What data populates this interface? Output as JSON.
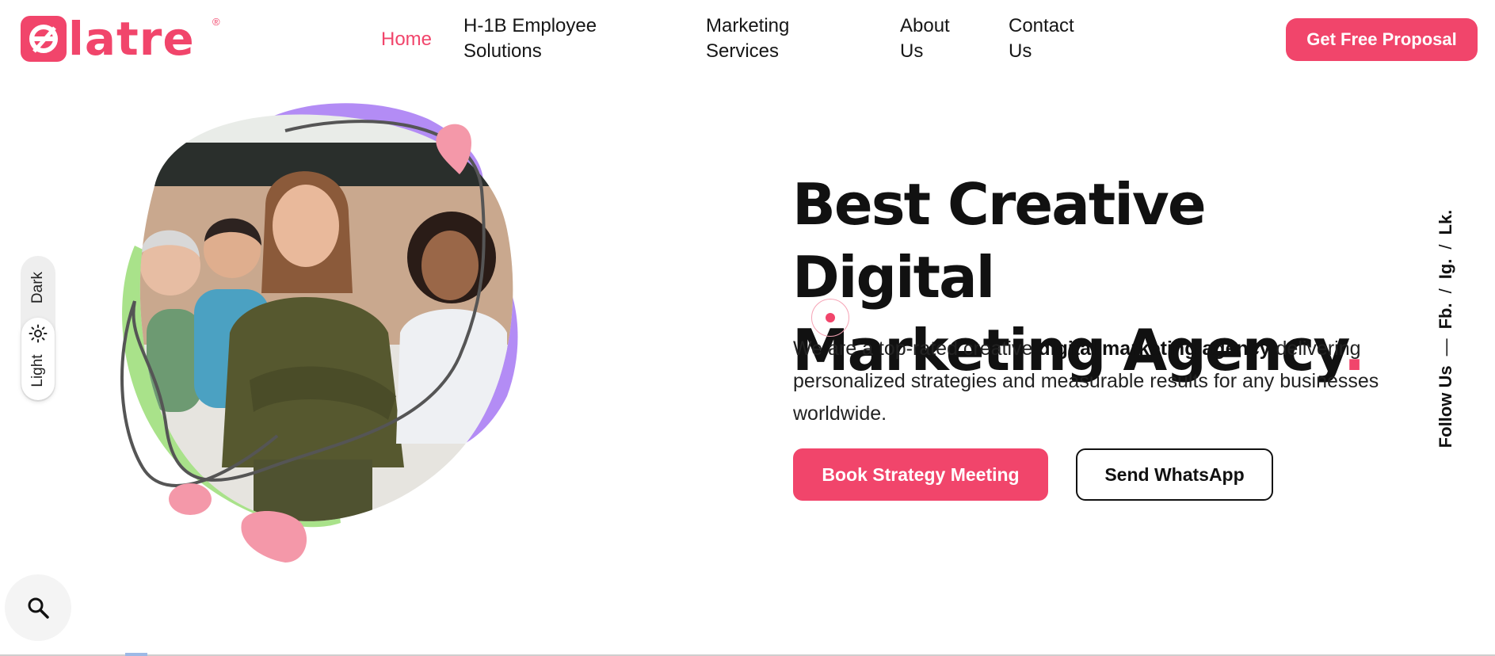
{
  "brand": {
    "name": "latre",
    "registered": "®",
    "accent": "#f1456b",
    "purple": "#b38cf5",
    "green": "#a9e28a"
  },
  "nav": {
    "items": [
      {
        "label": "Home",
        "active": true
      },
      {
        "label": "H-1B Employee Solutions",
        "line1": "H-1B Employee",
        "line2": "Solutions"
      },
      {
        "label": "Marketing Services",
        "line1": "Marketing",
        "line2": "Services"
      },
      {
        "label": "About Us",
        "line1": "About",
        "line2": "Us"
      },
      {
        "label": "Contact Us",
        "line1": "Contact",
        "line2": "Us"
      }
    ],
    "cta": "Get Free Proposal"
  },
  "theme_toggle": {
    "dark_label": "Dark",
    "light_label": "Light",
    "active": "Light"
  },
  "hero": {
    "title_line1": "Best Creative Digital",
    "title_line2": "Marketing Agency",
    "title_dot": ".",
    "desc_part1": "We are a top-rated creative ",
    "desc_bold": "digital marketing agency",
    "desc_part2": " delivering personalized strategies and measurable results for any businesses worldwide.",
    "primary_button": "Book Strategy Meeting",
    "secondary_button": "Send WhatsApp"
  },
  "social": {
    "follow_label": "Follow Us",
    "dash": "—",
    "links": [
      "Fb.",
      "Ig.",
      "Lk."
    ],
    "separator": "/"
  },
  "search": {
    "icon": "search-icon"
  }
}
